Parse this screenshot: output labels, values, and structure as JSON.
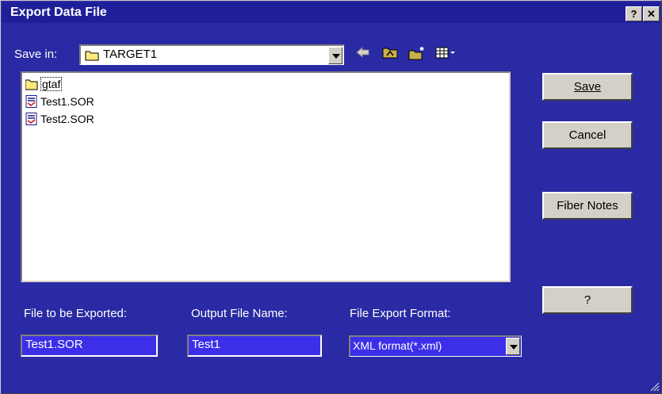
{
  "window": {
    "title": "Export Data File",
    "help_btn": "?",
    "close_btn": "✕"
  },
  "save_in": {
    "label": "Save in:",
    "value": "TARGET1"
  },
  "files": [
    {
      "name": "gtaf",
      "icon": "folder-icon"
    },
    {
      "name": "Test1.SOR",
      "icon": "sor-file-icon"
    },
    {
      "name": "Test2.SOR",
      "icon": "sor-file-icon"
    }
  ],
  "buttons": {
    "save": "Save",
    "cancel": "Cancel",
    "fiber_notes": "Fiber Notes",
    "help": "?"
  },
  "fields": {
    "exported_label": "File to be Exported:",
    "exported_value": "Test1.SOR",
    "output_label": "Output File Name:",
    "output_value": "Test1",
    "format_label": "File Export Format:",
    "format_value": "XML format(*.xml)"
  },
  "colors": {
    "background": "#2a2aa5",
    "field_highlight": "#3d2fe8",
    "button_face": "#d4d0c8"
  }
}
